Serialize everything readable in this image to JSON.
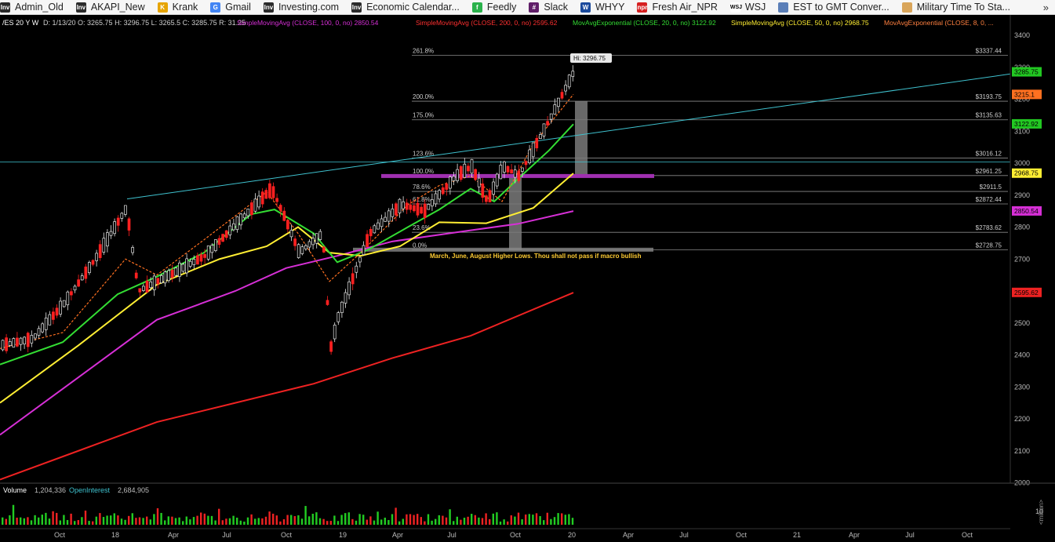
{
  "bookmarks": [
    {
      "label": "Admin_Old",
      "icon": "investing-icon",
      "icon_text": "Inv",
      "icon_color": "#2b2b2b"
    },
    {
      "label": "AKAPI_New",
      "icon": "investing-icon",
      "icon_text": "Inv",
      "icon_color": "#2b2b2b"
    },
    {
      "label": "Krank",
      "icon": "krank-icon",
      "icon_text": "K",
      "icon_color": "#e6a400"
    },
    {
      "label": "Gmail",
      "icon": "google-icon",
      "icon_text": "G",
      "icon_color": "#4285f4"
    },
    {
      "label": "Investing.com",
      "icon": "investing-icon",
      "icon_text": "Inv",
      "icon_color": "#2b2b2b"
    },
    {
      "label": "Economic Calendar...",
      "icon": "investing-icon",
      "icon_text": "Inv",
      "icon_color": "#2b2b2b"
    },
    {
      "label": "Feedly",
      "icon": "feedly-icon",
      "icon_text": "f",
      "icon_color": "#2bb24c"
    },
    {
      "label": "Slack",
      "icon": "slack-icon",
      "icon_text": "#",
      "icon_color": "#611f69"
    },
    {
      "label": "WHYY",
      "icon": "whyy-icon",
      "icon_text": "W",
      "icon_color": "#1b4a9c"
    },
    {
      "label": "Fresh Air_NPR",
      "icon": "npr-icon",
      "icon_text": "npr",
      "icon_color": "#d62021"
    },
    {
      "label": "WSJ",
      "icon": "wsj-icon",
      "icon_text": "WSJ",
      "icon_color": "#ffffff"
    },
    {
      "label": "EST to GMT Conver...",
      "icon": "page-icon",
      "icon_text": "",
      "icon_color": "#5b7fb8"
    },
    {
      "label": "Military Time To Sta...",
      "icon": "clock-icon",
      "icon_text": "",
      "icon_color": "#d9a55a"
    }
  ],
  "more_glyph": "»",
  "header": {
    "symbol": "/ES 20 Y W",
    "info": "D: 1/13/20   O: 3265.75   H: 3296.75   L: 3265.5   C: 3285.75   R: 31.25",
    "studies": [
      {
        "label": "SimpleMovingAvg (CLOSE, 100, 0, no)",
        "value": "2850.54",
        "color": "#d62fd6"
      },
      {
        "label": "SimpleMovingAvg (CLOSE, 200, 0, no)",
        "value": "2595.62",
        "color": "#ff3030"
      },
      {
        "label": "MovAvgExponential (CLOSE, 20, 0, no)",
        "value": "3122.92",
        "color": "#33dd33"
      },
      {
        "label": "SimpleMovingAvg (CLOSE, 50, 0, no)",
        "value": "2968.75",
        "color": "#ffee33"
      },
      {
        "label": "MovAvgExponential (CLOSE, 8, 0, ...",
        "value": "",
        "color": "#ff8040"
      }
    ]
  },
  "colors": {
    "up": "#e8e8e8",
    "down": "#ff2020",
    "fib": "#8a8a8a",
    "trendline": "#3fc2cf",
    "volume_up": "#22cc22",
    "volume_down": "#ee2222"
  },
  "y_ticks": [
    "3400",
    "3300",
    "3200",
    "3100",
    "3000",
    "2900",
    "2800",
    "2700",
    "2600",
    "2500",
    "2400",
    "2300",
    "2200",
    "2100",
    "2000"
  ],
  "x_ticks": [
    "Oct",
    "18",
    "Apr",
    "Jul",
    "Oct",
    "19",
    "Apr",
    "Jul",
    "Oct",
    "20",
    "Apr",
    "Jul",
    "Oct",
    "21",
    "Apr",
    "Jul",
    "Oct"
  ],
  "price_badges": [
    {
      "value": "3285.75",
      "color": "#22c822"
    },
    {
      "value": "3215.1",
      "color": "#ff7020"
    },
    {
      "value": "3122.92",
      "color": "#22c822"
    },
    {
      "value": "2968.75",
      "color": "#ffee33"
    },
    {
      "value": "2850.54",
      "color": "#d62fd6"
    },
    {
      "value": "2595.62",
      "color": "#ee2222"
    }
  ],
  "fibs": [
    {
      "pct": "261.8%",
      "price": "$3337.44"
    },
    {
      "pct": "200.0%",
      "price": "$3193.75"
    },
    {
      "pct": "175.0%",
      "price": "$3135.63"
    },
    {
      "pct": "123.6%",
      "price": "$3016.12"
    },
    {
      "pct": "100.0%",
      "price": "$2961.25"
    },
    {
      "pct": "78.6%",
      "price": "$2911.5"
    },
    {
      "pct": "61.8%",
      "price": "$2872.44"
    },
    {
      "pct": "23.6%",
      "price": "$2783.62"
    },
    {
      "pct": "0.0%",
      "price": "$2728.75"
    }
  ],
  "annotation": "March, June, August Higher Lows. Thou shall not pass if macro bullish",
  "hi_label": "Hi: 3296.75",
  "volume": {
    "label": "Volume",
    "value": "1,204,336",
    "oi_label": "OpenInterest",
    "oi_value": "2,684,905",
    "y_tick": "10",
    "unit": "<million>"
  }
}
